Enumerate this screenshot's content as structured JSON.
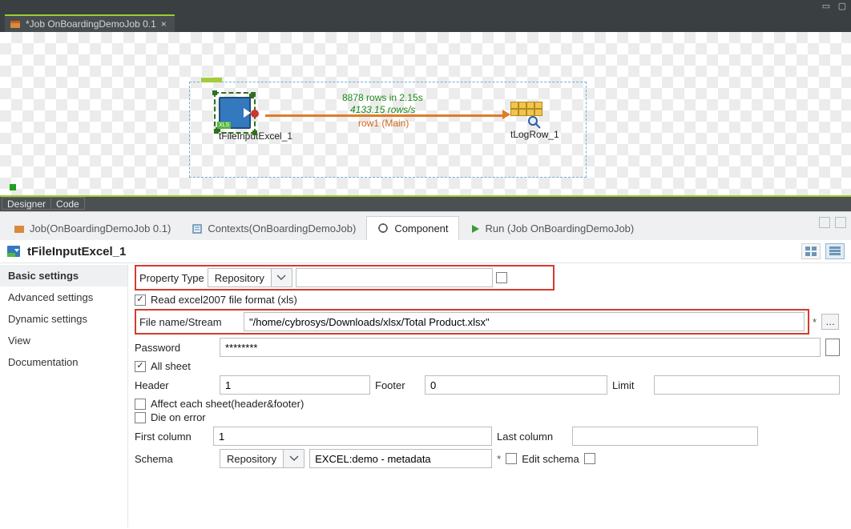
{
  "editor_tab": {
    "title": "*Job OnBoardingDemoJob 0.1"
  },
  "canvas": {
    "node1_label": "tFileInputExcel_1",
    "node2_label": "tLogRow_1",
    "stats_rows": "8878 rows in 2.15s",
    "stats_rate": "4133.15 rows/s",
    "link_label": "row1 (Main)"
  },
  "mode_tabs": {
    "designer": "Designer",
    "code": "Code"
  },
  "mid_tabs": {
    "job": "Job(OnBoardingDemoJob 0.1)",
    "contexts": "Contexts(OnBoardingDemoJob)",
    "component": "Component",
    "run": "Run (Job OnBoardingDemoJob)"
  },
  "component_title": "tFileInputExcel_1",
  "side_nav": {
    "basic": "Basic settings",
    "advanced": "Advanced settings",
    "dynamic": "Dynamic settings",
    "view": "View",
    "doc": "Documentation"
  },
  "fields": {
    "property_type_label": "Property Type",
    "property_type_value": "Repository",
    "property_type_ref": "",
    "read_2007_label": "Read excel2007 file format (xls)",
    "file_label": "File name/Stream",
    "file_value": "\"/home/cybrosys/Downloads/xlsx/Total Product.xlsx\"",
    "password_label": "Password",
    "password_value": "********",
    "all_sheet_label": "All sheet",
    "header_label": "Header",
    "header_value": "1",
    "footer_label": "Footer",
    "footer_value": "0",
    "limit_label": "Limit",
    "limit_value": "",
    "affect_label": "Affect each sheet(header&footer)",
    "die_label": "Die on error",
    "first_col_label": "First column",
    "first_col_value": "1",
    "last_col_label": "Last column",
    "last_col_value": "",
    "schema_label": "Schema",
    "schema_value": "Repository",
    "schema_ref": "EXCEL:demo - metadata",
    "edit_schema_label": "Edit schema"
  }
}
